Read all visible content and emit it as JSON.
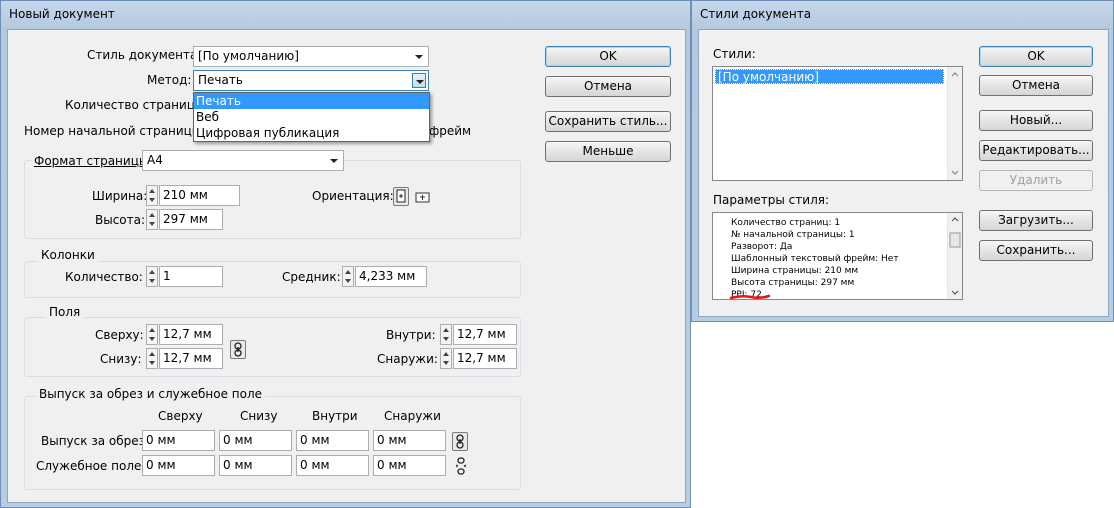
{
  "new_document": {
    "title": "Новый документ",
    "style_label": "Стиль документа:",
    "style_value": "[По умолчанию]",
    "method_label": "Метод:",
    "method_value": "Печать",
    "method_options": [
      "Печать",
      "Веб",
      "Цифровая публикация"
    ],
    "pages_label": "Количество страниц:",
    "start_page_label": "Номер начальной страницы:",
    "frame_partial": "фрейм",
    "page_format_label": "Формат страницы:",
    "page_format_value": "A4",
    "width_label": "Ширина:",
    "width_value": "210 мм",
    "height_label": "Высота:",
    "height_value": "297 мм",
    "orientation_label": "Ориентация:",
    "buttons": {
      "ok": "OK",
      "cancel": "Отмена",
      "save_style": "Сохранить стиль...",
      "less": "Меньше"
    },
    "columns": {
      "title": "Колонки",
      "count_label": "Количество:",
      "count_value": "1",
      "gutter_label": "Средник:",
      "gutter_value": "4,233 мм"
    },
    "margins": {
      "title": "Поля",
      "top_label": "Сверху:",
      "top_value": "12,7 мм",
      "bottom_label": "Снизу:",
      "bottom_value": "12,7 мм",
      "inside_label": "Внутри:",
      "inside_value": "12,7 мм",
      "outside_label": "Снаружи:",
      "outside_value": "12,7 мм"
    },
    "bleed": {
      "title": "Выпуск за обрез и служебное поле",
      "headers": [
        "Сверху",
        "Снизу",
        "Внутри",
        "Снаружи"
      ],
      "bleed_label": "Выпуск за обрез:",
      "bleed_values": [
        "0 мм",
        "0 мм",
        "0 мм",
        "0 мм"
      ],
      "slug_label": "Служебное поле:",
      "slug_values": [
        "0 мм",
        "0 мм",
        "0 мм",
        "0 мм"
      ]
    }
  },
  "document_styles": {
    "title": "Стили документа",
    "styles_label": "Стили:",
    "styles_items": [
      "[По умолчанию]"
    ],
    "params_label": "Параметры стиля:",
    "params_lines": [
      "Количество страниц:  1",
      "№ начальной страницы:  1",
      "Разворот:  Да",
      "Шаблонный текстовый фрейм:  Нет",
      "Ширина страницы:  210 мм",
      "Высота страницы:  297 мм",
      "PPI:  72"
    ],
    "buttons": {
      "ok": "OK",
      "cancel": "Отмена",
      "new": "Новый...",
      "edit": "Редактировать...",
      "delete": "Удалить",
      "load": "Загрузить...",
      "save": "Сохранить..."
    },
    "annotation_color": "#ee1111"
  }
}
